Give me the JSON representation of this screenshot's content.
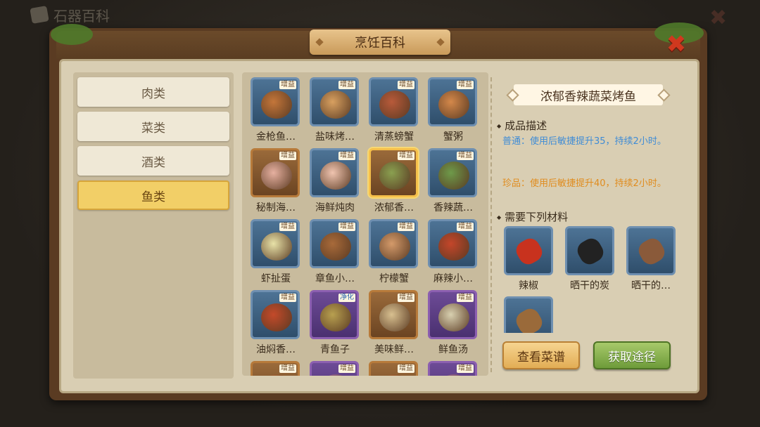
{
  "background": {
    "title": "石器百科"
  },
  "window": {
    "title": "烹饪百科",
    "close_symbol": "✖"
  },
  "categories": [
    {
      "label": "肉类",
      "active": false
    },
    {
      "label": "菜类",
      "active": false
    },
    {
      "label": "酒类",
      "active": false
    },
    {
      "label": "鱼类",
      "active": true
    }
  ],
  "dishes": [
    {
      "name": "金枪鱼…",
      "badge": "增益",
      "frame": "blue",
      "selected": false
    },
    {
      "name": "盐味烤…",
      "badge": "增益",
      "frame": "blue",
      "selected": false
    },
    {
      "name": "清蒸螃蟹",
      "badge": "增益",
      "frame": "blue",
      "selected": false
    },
    {
      "name": "蟹粥",
      "badge": "增益",
      "frame": "blue",
      "selected": false
    },
    {
      "name": "秘制海…",
      "badge": "增益",
      "frame": "orange",
      "selected": false
    },
    {
      "name": "海鲜炖肉",
      "badge": "增益",
      "frame": "blue",
      "selected": false
    },
    {
      "name": "浓郁香…",
      "badge": "增益",
      "frame": "orange",
      "selected": true
    },
    {
      "name": "香辣蔬…",
      "badge": "增益",
      "frame": "blue",
      "selected": false
    },
    {
      "name": "虾扯蛋",
      "badge": "增益",
      "frame": "blue",
      "selected": false
    },
    {
      "name": "章鱼小…",
      "badge": "增益",
      "frame": "blue",
      "selected": false
    },
    {
      "name": "柠檬蟹",
      "badge": "增益",
      "frame": "blue",
      "selected": false
    },
    {
      "name": "麻辣小…",
      "badge": "增益",
      "frame": "blue",
      "selected": false
    },
    {
      "name": "油焖香…",
      "badge": "增益",
      "frame": "blue",
      "selected": false
    },
    {
      "name": "青鱼子",
      "badge": "净化",
      "frame": "purple",
      "selected": false
    },
    {
      "name": "美味鲜…",
      "badge": "增益",
      "frame": "orange",
      "selected": false
    },
    {
      "name": "鲜鱼汤",
      "badge": "增益",
      "frame": "purple",
      "selected": false
    },
    {
      "name": "",
      "badge": "增益",
      "frame": "orange",
      "selected": false
    },
    {
      "name": "",
      "badge": "增益",
      "frame": "purple",
      "selected": false
    },
    {
      "name": "",
      "badge": "增益",
      "frame": "orange",
      "selected": false
    },
    {
      "name": "",
      "badge": "增益",
      "frame": "purple",
      "selected": false
    }
  ],
  "detail": {
    "title": "浓郁香辣蔬菜烤鱼",
    "desc_heading": "成品描述",
    "normal_desc": "普通：使用后敏捷提升35，持续2小时。",
    "rare_desc": "珍品：使用后敏捷提升40，持续2小时。",
    "materials_heading": "需要下列材料",
    "materials": [
      {
        "name": "辣椒",
        "icon": "chili-icon"
      },
      {
        "name": "晒干的炭",
        "icon": "charcoal-icon"
      },
      {
        "name": "晒干的…",
        "icon": "mushroom-icon"
      },
      {
        "name": "",
        "icon": "fish-icon"
      }
    ],
    "view_recipe_label": "查看菜谱",
    "get_source_label": "获取途径"
  },
  "colors": {
    "normal": "#3f8cd6",
    "rare": "#e08c1e",
    "active_tab": "#f2cf67"
  }
}
